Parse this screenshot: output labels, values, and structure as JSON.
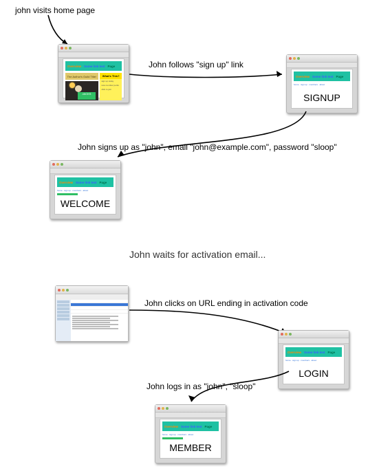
{
  "diagram": {
    "title_action": "john visits home page",
    "intermission": "John waits for activation email...",
    "steps": [
      {
        "id": "step1",
        "text": "John follows \"sign up\" link"
      },
      {
        "id": "step2",
        "text": "John signs up as \"john\", email \"john@example.com\", password \"sloop\""
      },
      {
        "id": "step3",
        "text": "John clicks on URL ending in activation code"
      },
      {
        "id": "step4",
        "text": "John logs in as \"john\", \"sloop\""
      }
    ],
    "screens": {
      "signup": "SIGNUP",
      "welcome": "WELCOME",
      "login": "LOGIN",
      "member": "MEMBER"
    }
  },
  "mock_browser": {
    "banner_parts": {
      "overview": "Overview",
      "link": "Some link text",
      "page": "Page"
    },
    "home": {
      "hero": "The Author's Guild Title!",
      "sign": "JACKS",
      "sticky_head": "What's This?",
      "sticky_lines": [
        "sign up today",
        "new member perks",
        "click to join"
      ]
    },
    "plain_linkline": "home · sign up · members · about"
  }
}
